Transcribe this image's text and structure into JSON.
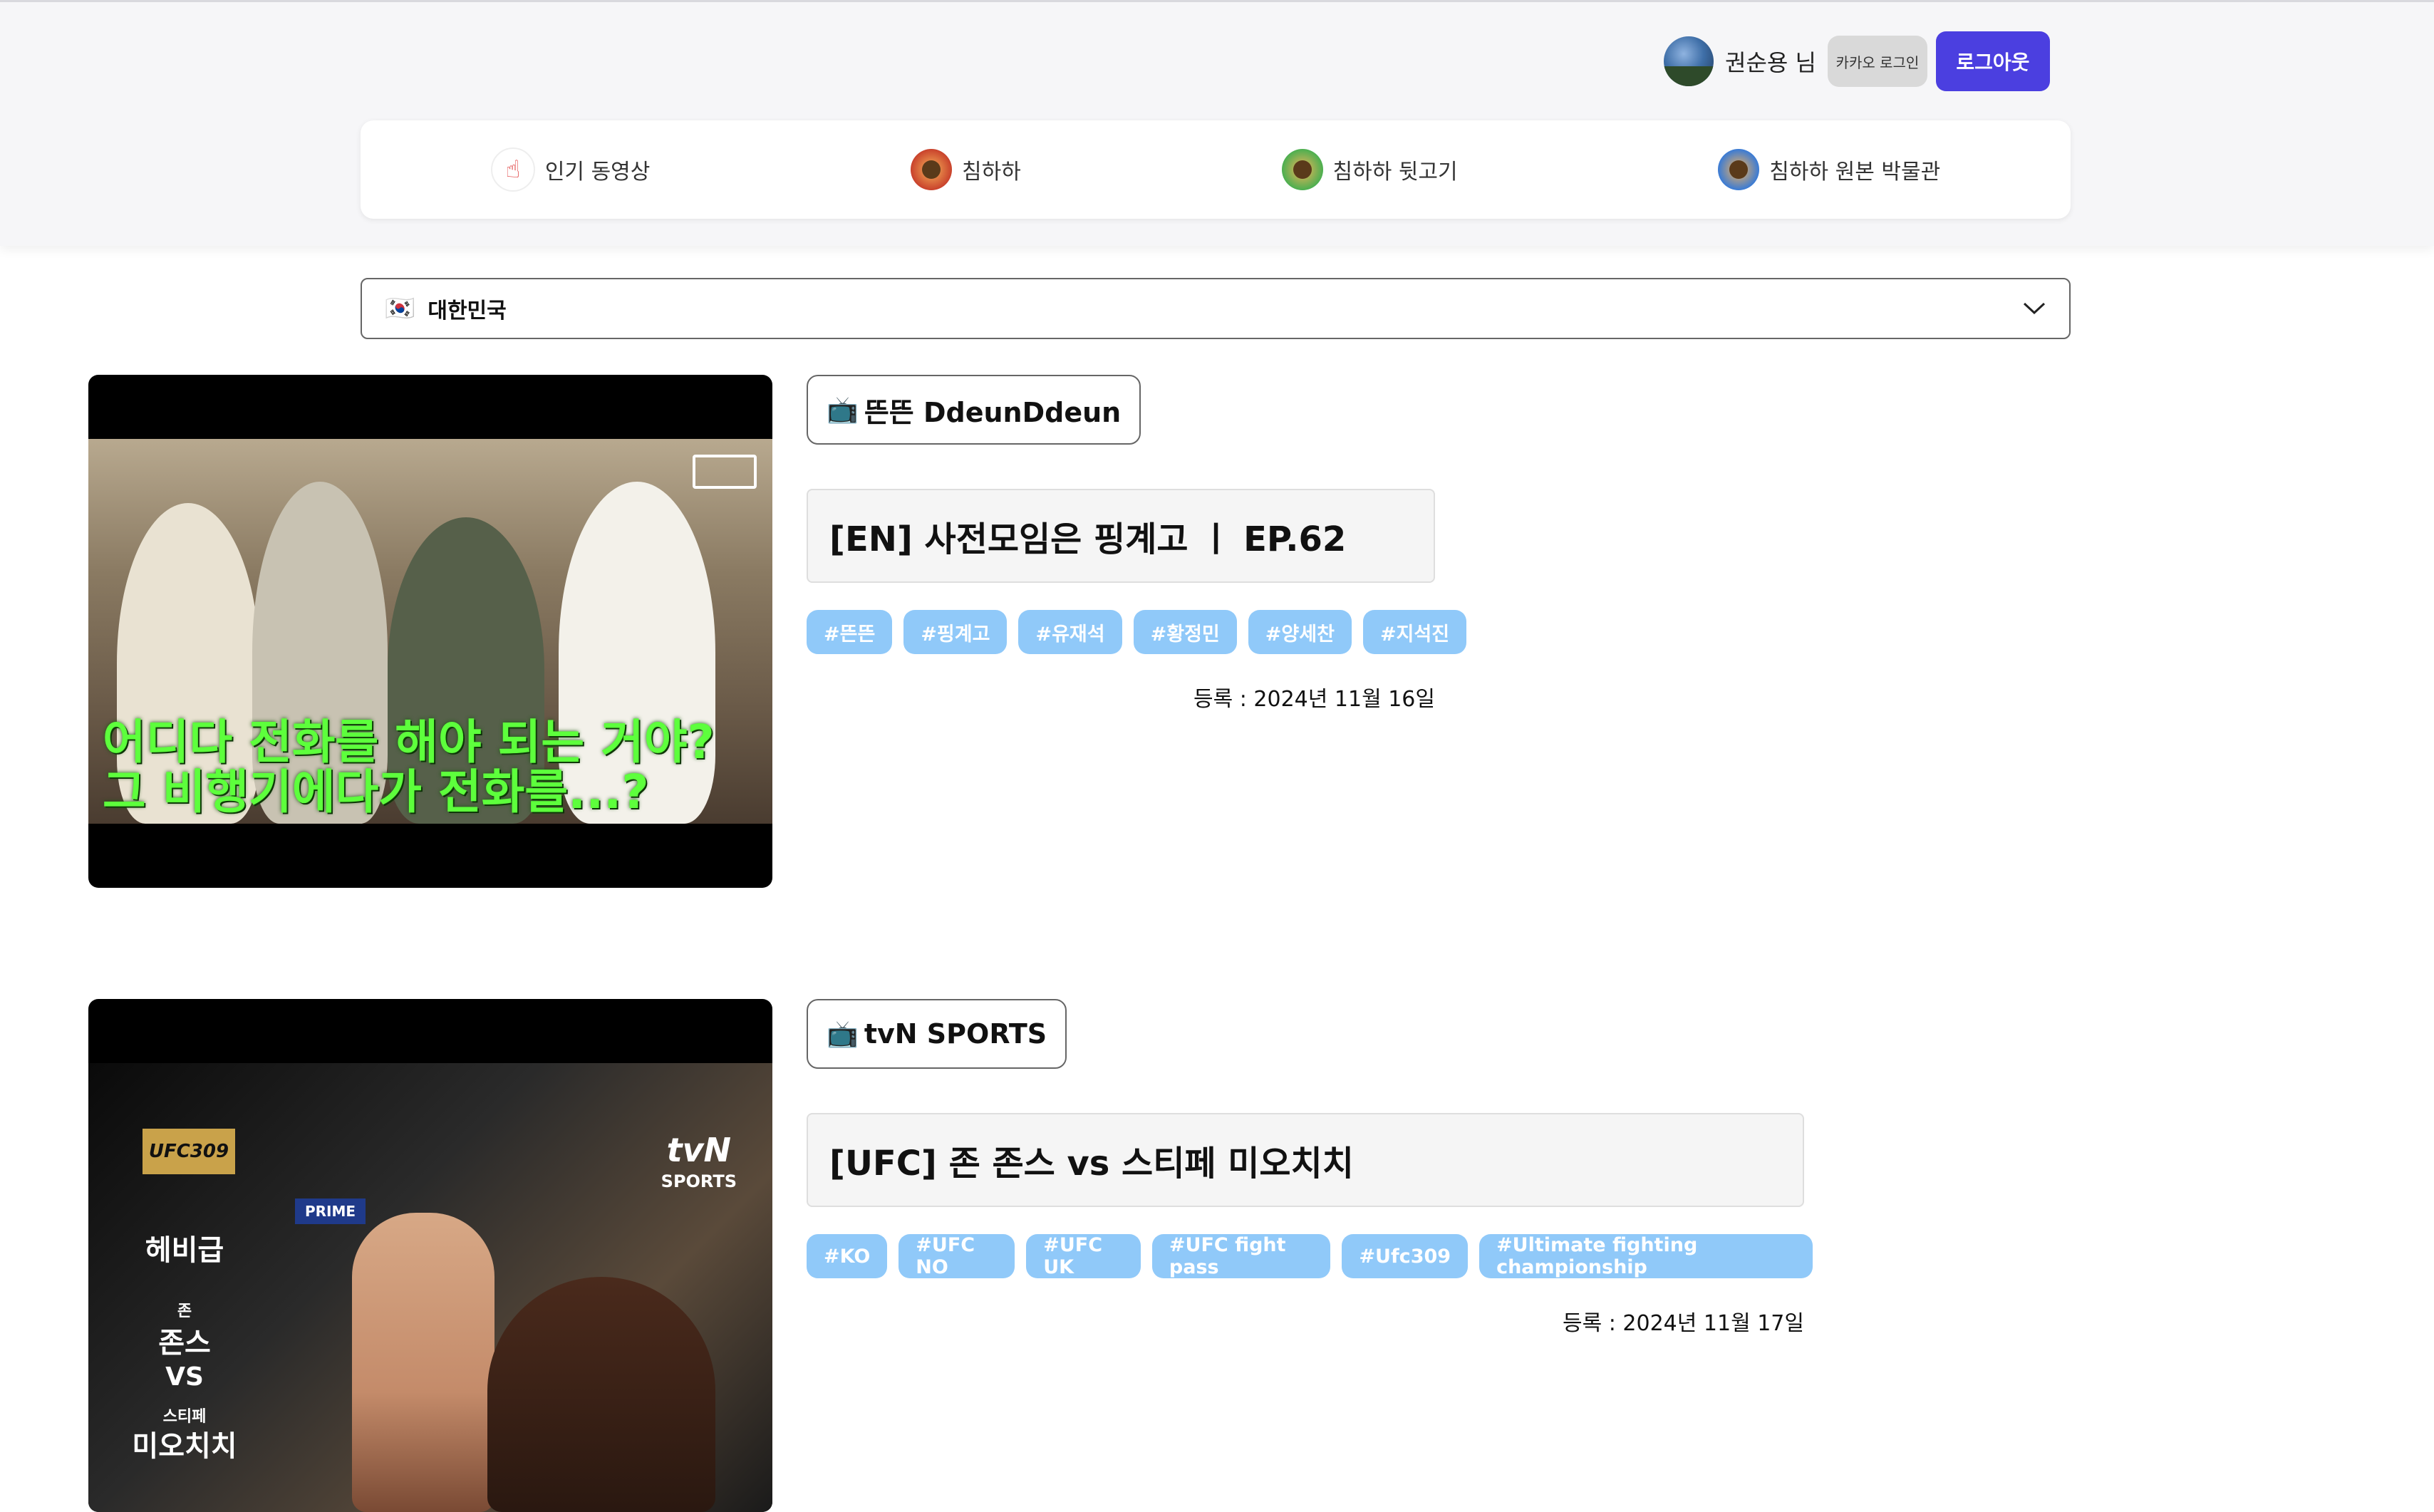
{
  "header": {
    "user_name": "권순용 님",
    "kakao_label": "카카오 로그인",
    "logout_label": "로그아웃"
  },
  "nav": {
    "items": [
      {
        "label": "인기 동영상",
        "icon": "pointing-hand-icon"
      },
      {
        "label": "침하하",
        "icon": "chimhaha-mascot-icon"
      },
      {
        "label": "침하하 뒷고기",
        "icon": "chimhaha-mascot-icon"
      },
      {
        "label": "침하하 원본 박물관",
        "icon": "chimhaha-mascot-icon"
      }
    ]
  },
  "country_select": {
    "flag": "🇰🇷",
    "value": "대한민국"
  },
  "videos": [
    {
      "channel": "뜬뜬 DdeunDdeun",
      "title": "[EN] 사전모임은 핑계고 ㅣ EP.62",
      "tags": [
        "#뜬뜬",
        "#핑계고",
        "#유재석",
        "#황정민",
        "#양세찬",
        "#지석진"
      ],
      "date": "등록 : 2024년 11월 16일",
      "thumb_caption_1": "어디다 전화를 해야 되는 거야?",
      "thumb_caption_2": "그 비행기에다가 전화를...?"
    },
    {
      "channel": "tvN SPORTS",
      "title": "[UFC] 존 존스 vs 스티페 미오치치",
      "tags": [
        "#KO",
        "#UFC NO",
        "#UFC UK",
        "#UFC fight pass",
        "#Ufc309",
        "#Ultimate fighting championship"
      ],
      "date": "등록 : 2024년 11월 17일",
      "thumb_badge": "UFC309",
      "thumb_weight": "헤비급",
      "thumb_f1_given": "존",
      "thumb_f1_family": "존스",
      "thumb_vs": "VS",
      "thumb_f2_given": "스티페",
      "thumb_f2_family": "미오치치",
      "thumb_logo_top": "tvN",
      "thumb_logo_bottom": "SPORTS",
      "thumb_prime": "PRIME"
    }
  ],
  "colors": {
    "accent": "#4b3fe0",
    "tag_bg": "#90c9f9",
    "caption": "#5dff3c"
  }
}
